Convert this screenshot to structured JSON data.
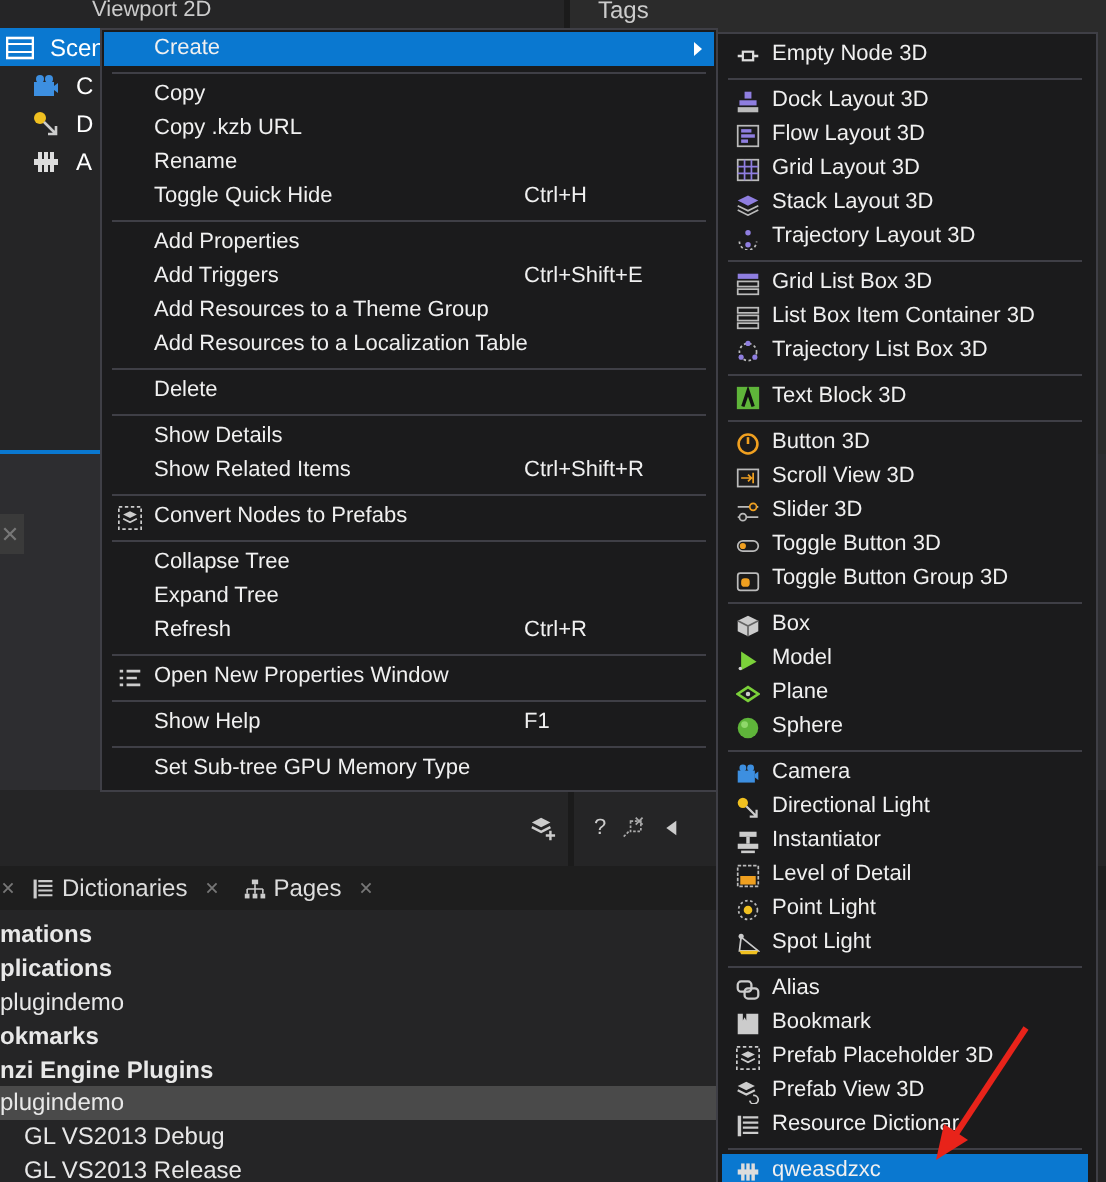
{
  "tree": {
    "header": "Viewport 2D",
    "items": [
      {
        "label": "Scen",
        "selected": true
      },
      {
        "label": "C",
        "selected": false
      },
      {
        "label": "D",
        "selected": false
      },
      {
        "label": "A",
        "selected": false
      }
    ]
  },
  "side_panel": {
    "title": "Tags"
  },
  "toolbar": {
    "help": "?"
  },
  "bottom_tabs": [
    {
      "label": "Dictionaries"
    },
    {
      "label": "Pages"
    }
  ],
  "project_list": [
    {
      "label": "mations",
      "bold": true,
      "selected": false
    },
    {
      "label": "plications",
      "bold": true,
      "selected": false
    },
    {
      "label": "plugindemo",
      "bold": false,
      "selected": false
    },
    {
      "label": "okmarks",
      "bold": true,
      "selected": false
    },
    {
      "label": "nzi Engine Plugins",
      "bold": true,
      "selected": false
    },
    {
      "label": "plugindemo",
      "bold": false,
      "selected": true
    },
    {
      "label": "GL VS2013 Debug",
      "bold": false,
      "selected": false
    },
    {
      "label": "GL VS2013 Release",
      "bold": false,
      "selected": false
    }
  ],
  "context_menu": {
    "items": [
      {
        "kind": "item",
        "label": "Create",
        "selected": true,
        "has_submenu": true
      },
      {
        "kind": "separator"
      },
      {
        "kind": "item",
        "label": "Copy",
        "selected": false,
        "has_submenu": false
      },
      {
        "kind": "item",
        "label": "Copy .kzb URL",
        "selected": false,
        "has_submenu": false
      },
      {
        "kind": "item",
        "label": "Rename",
        "selected": false,
        "has_submenu": false
      },
      {
        "kind": "item",
        "label": "Toggle Quick Hide",
        "shortcut": "Ctrl+H",
        "selected": false,
        "has_submenu": false
      },
      {
        "kind": "separator"
      },
      {
        "kind": "item",
        "label": "Add Properties",
        "selected": false,
        "has_submenu": false
      },
      {
        "kind": "item",
        "label": "Add Triggers",
        "shortcut": "Ctrl+Shift+E",
        "selected": false,
        "has_submenu": false
      },
      {
        "kind": "item",
        "label": "Add Resources to a Theme Group",
        "selected": false,
        "has_submenu": false
      },
      {
        "kind": "item",
        "label": "Add Resources to a Localization Table",
        "selected": false,
        "has_submenu": false
      },
      {
        "kind": "separator"
      },
      {
        "kind": "item",
        "label": "Delete",
        "selected": false,
        "has_submenu": false
      },
      {
        "kind": "separator"
      },
      {
        "kind": "item",
        "label": "Show Details",
        "selected": false,
        "has_submenu": false
      },
      {
        "kind": "item",
        "label": "Show Related Items",
        "shortcut": "Ctrl+Shift+R",
        "selected": false,
        "has_submenu": false
      },
      {
        "kind": "separator"
      },
      {
        "kind": "item",
        "label": "Convert Nodes to Prefabs",
        "selected": false,
        "has_submenu": false
      },
      {
        "kind": "separator"
      },
      {
        "kind": "item",
        "label": "Collapse Tree",
        "selected": false,
        "has_submenu": false
      },
      {
        "kind": "item",
        "label": "Expand Tree",
        "selected": false,
        "has_submenu": false
      },
      {
        "kind": "item",
        "label": "Refresh",
        "shortcut": "Ctrl+R",
        "selected": false,
        "has_submenu": false
      },
      {
        "kind": "separator"
      },
      {
        "kind": "item",
        "label": "Open New Properties Window",
        "selected": false,
        "has_submenu": false
      },
      {
        "kind": "separator"
      },
      {
        "kind": "item",
        "label": "Show Help",
        "shortcut": "F1",
        "selected": false,
        "has_submenu": false
      },
      {
        "kind": "separator"
      },
      {
        "kind": "item",
        "label": "Set Sub-tree GPU Memory Type",
        "selected": false,
        "has_submenu": false
      }
    ]
  },
  "submenu": {
    "items": [
      {
        "kind": "item",
        "label": "Empty Node 3D",
        "selected": false
      },
      {
        "kind": "separator"
      },
      {
        "kind": "item",
        "label": "Dock Layout 3D",
        "selected": false
      },
      {
        "kind": "item",
        "label": "Flow Layout 3D",
        "selected": false
      },
      {
        "kind": "item",
        "label": "Grid Layout 3D",
        "selected": false
      },
      {
        "kind": "item",
        "label": "Stack Layout 3D",
        "selected": false
      },
      {
        "kind": "item",
        "label": "Trajectory Layout 3D",
        "selected": false
      },
      {
        "kind": "separator"
      },
      {
        "kind": "item",
        "label": "Grid List Box 3D",
        "selected": false
      },
      {
        "kind": "item",
        "label": "List Box Item Container 3D",
        "selected": false
      },
      {
        "kind": "item",
        "label": "Trajectory List Box 3D",
        "selected": false
      },
      {
        "kind": "separator"
      },
      {
        "kind": "item",
        "label": "Text Block 3D",
        "selected": false
      },
      {
        "kind": "separator"
      },
      {
        "kind": "item",
        "label": "Button 3D",
        "selected": false
      },
      {
        "kind": "item",
        "label": "Scroll View 3D",
        "selected": false
      },
      {
        "kind": "item",
        "label": "Slider 3D",
        "selected": false
      },
      {
        "kind": "item",
        "label": "Toggle Button 3D",
        "selected": false
      },
      {
        "kind": "item",
        "label": "Toggle Button Group 3D",
        "selected": false
      },
      {
        "kind": "separator"
      },
      {
        "kind": "item",
        "label": "Box",
        "selected": false
      },
      {
        "kind": "item",
        "label": "Model",
        "selected": false
      },
      {
        "kind": "item",
        "label": "Plane",
        "selected": false
      },
      {
        "kind": "item",
        "label": "Sphere",
        "selected": false
      },
      {
        "kind": "separator"
      },
      {
        "kind": "item",
        "label": "Camera",
        "selected": false
      },
      {
        "kind": "item",
        "label": "Directional Light",
        "selected": false
      },
      {
        "kind": "item",
        "label": "Instantiator",
        "selected": false
      },
      {
        "kind": "item",
        "label": "Level of Detail",
        "selected": false
      },
      {
        "kind": "item",
        "label": "Point Light",
        "selected": false
      },
      {
        "kind": "item",
        "label": "Spot Light",
        "selected": false
      },
      {
        "kind": "separator"
      },
      {
        "kind": "item",
        "label": "Alias",
        "selected": false
      },
      {
        "kind": "item",
        "label": "Bookmark",
        "selected": false
      },
      {
        "kind": "item",
        "label": "Prefab Placeholder 3D",
        "selected": false
      },
      {
        "kind": "item",
        "label": "Prefab View 3D",
        "selected": false
      },
      {
        "kind": "item",
        "label": "Resource Dictionar",
        "selected": false
      },
      {
        "kind": "separator"
      },
      {
        "kind": "item",
        "label": "qweasdzxc",
        "selected": true
      }
    ]
  }
}
